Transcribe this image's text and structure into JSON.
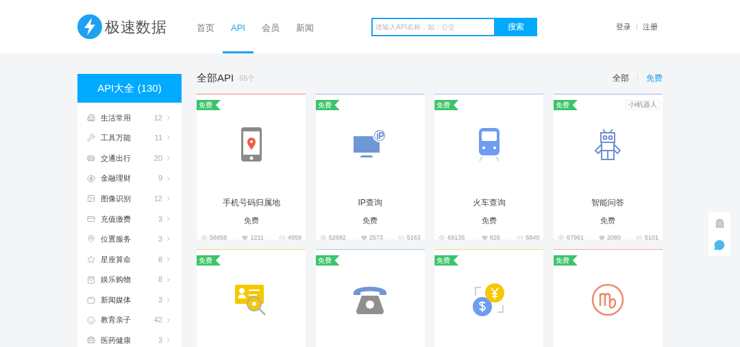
{
  "logo": {
    "text": "极速数据"
  },
  "nav": [
    {
      "label": "首页",
      "selected": false
    },
    {
      "label": "API",
      "selected": true
    },
    {
      "label": "会员",
      "selected": false
    },
    {
      "label": "新闻",
      "selected": false
    }
  ],
  "search": {
    "placeholder": "请输入API名称，如：公交",
    "button": "搜索"
  },
  "auth": [
    "登录",
    "注册"
  ],
  "sidebar": {
    "title": "API大全 (130)",
    "items": [
      {
        "label": "生活常用",
        "count": "12"
      },
      {
        "label": "工具万能",
        "count": "11"
      },
      {
        "label": "交通出行",
        "count": "20"
      },
      {
        "label": "金融理财",
        "count": "9"
      },
      {
        "label": "图像识别",
        "count": "12"
      },
      {
        "label": "充值缴费",
        "count": "3"
      },
      {
        "label": "位置服务",
        "count": "3"
      },
      {
        "label": "星座算命",
        "count": "8"
      },
      {
        "label": "娱乐购物",
        "count": "8"
      },
      {
        "label": "新闻媒体",
        "count": "3"
      },
      {
        "label": "教育亲子",
        "count": "42"
      },
      {
        "label": "医药健康",
        "count": "3"
      }
    ]
  },
  "main": {
    "title": "全部API",
    "count": "65个",
    "filters": [
      {
        "label": "全部",
        "selected": false
      },
      {
        "label": "免费",
        "selected": true
      }
    ]
  },
  "cards": [
    {
      "kind": "phone",
      "color": "#f08c7a",
      "badge": "免费",
      "title": "手机号码归属地",
      "price": "免费",
      "views": "56858",
      "likes": "1211",
      "links": "4959"
    },
    {
      "kind": "ip",
      "color": "#9fb4e0",
      "badge": "免费",
      "title": "IP查询",
      "price": "免费",
      "views": "52692",
      "likes": "2573",
      "links": "5163"
    },
    {
      "kind": "train",
      "color": "#9fc0f0",
      "badge": "免费",
      "title": "火车查询",
      "price": "免费",
      "views": "69135",
      "likes": "826",
      "links": "6840"
    },
    {
      "kind": "robot",
      "color": "#9fb4e0",
      "badge": "免费",
      "tag": "小i机器人",
      "title": "智能问答",
      "price": "免费",
      "views": "67961",
      "likes": "2080",
      "links": "5101"
    },
    {
      "kind": "idcard",
      "color": "#f5d86a",
      "badge": "免费"
    },
    {
      "kind": "telephone",
      "color": "#b8c8e0",
      "badge": "免费"
    },
    {
      "kind": "exchange",
      "color": "#f5d86a",
      "badge": "免费"
    },
    {
      "kind": "virgo",
      "color": "#f0a890",
      "badge": "免费"
    }
  ]
}
